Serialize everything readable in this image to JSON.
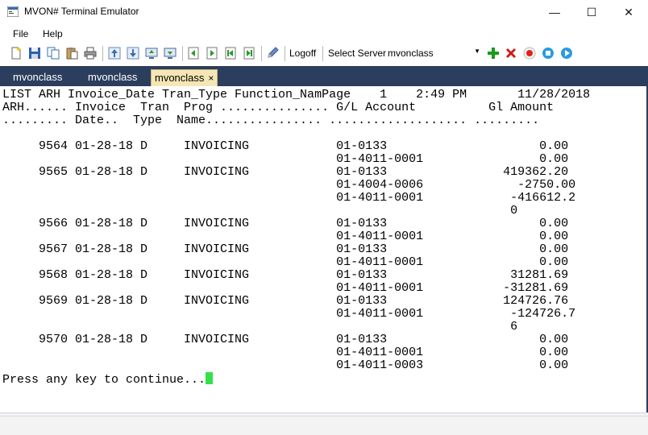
{
  "window": {
    "title": "MVON# Terminal Emulator",
    "minimize": "—",
    "maximize": "☐",
    "close": "✕"
  },
  "menu": {
    "file": "File",
    "help": "Help"
  },
  "toolbar": {
    "logoff": "Logoff",
    "select_server_label": "Select Server",
    "server_value": "mvonclass",
    "icons": [
      "new-icon",
      "save-icon",
      "copy-icon",
      "paste-icon",
      "print-icon",
      "upload-icon",
      "download-icon",
      "screen-up-icon",
      "screen-down-icon",
      "page-back-icon",
      "page-forward-icon",
      "page-first-icon",
      "page-last-icon",
      "pen-icon",
      "add-icon",
      "delete-icon",
      "record-icon",
      "stop-icon",
      "play-icon"
    ],
    "colors": {
      "add": "#1a9a1a",
      "delete": "#d01818",
      "record": "#e02020",
      "stop": "#2a9be0",
      "play": "#2a9be0"
    }
  },
  "tabs": [
    {
      "label": "mvonclass",
      "active": false
    },
    {
      "label": "mvonclass",
      "active": false
    },
    {
      "label": "mvonclass",
      "active": true,
      "close": "×"
    }
  ],
  "terminal": {
    "header": [
      "LIST ARH Invoice_Date Tran_Type Function_NamPage    1    2:49 PM       11/28/2018",
      "ARH...... Invoice  Tran  Prog ............... G/L Account          Gl Amount",
      "......... Date..  Type  Name................ ................... ........."
    ],
    "rows": [
      "     9564 01-28-18 D     INVOICING            01-0133                     0.00",
      "                                              01-4011-0001                0.00",
      "     9565 01-28-18 D     INVOICING            01-0133                419362.20",
      "                                              01-4004-0006             -2750.00",
      "                                              01-4011-0001            -416612.2",
      "                                                                      0",
      "     9566 01-28-18 D     INVOICING            01-0133                     0.00",
      "                                              01-4011-0001                0.00",
      "     9567 01-28-18 D     INVOICING            01-0133                     0.00",
      "                                              01-4011-0001                0.00",
      "     9568 01-28-18 D     INVOICING            01-0133                 31281.69",
      "                                              01-4011-0001           -31281.69",
      "     9569 01-28-18 D     INVOICING            01-0133                124726.76",
      "                                              01-4011-0001            -124726.7",
      "                                                                      6",
      "     9570 01-28-18 D     INVOICING            01-0133                     0.00",
      "                                              01-4011-0001                0.00",
      "                                              01-4011-0003                0.00"
    ],
    "prompt": "Press any key to continue..."
  }
}
